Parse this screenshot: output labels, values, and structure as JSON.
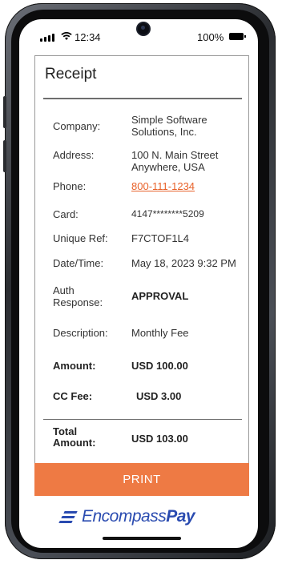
{
  "status": {
    "time": "12:34",
    "battery": "100%"
  },
  "receipt": {
    "title": "Receipt",
    "rows": [
      {
        "label": "Company:",
        "value": "Simple Software Solutions, Inc."
      },
      {
        "label": "Address:",
        "value": "100 N. Main Street Anywhere, USA"
      },
      {
        "label": "Phone:",
        "value": "800-111-1234"
      },
      {
        "label": "Card:",
        "value": "4147********5209"
      },
      {
        "label": "Unique Ref:",
        "value": "F7CTOF1L4"
      },
      {
        "label": "Date/Time:",
        "value": "May 18, 2023 9:32 PM"
      },
      {
        "label": "Auth Response:",
        "value": "APPROVAL"
      },
      {
        "label": "Description:",
        "value": "Monthly Fee"
      },
      {
        "label": "Amount:",
        "value": "USD 100.00"
      },
      {
        "label": "CC Fee:",
        "value": "USD 3.00"
      },
      {
        "label": "Total Amount:",
        "value": "USD 103.00"
      }
    ]
  },
  "actions": {
    "print_label": "PRINT"
  },
  "brand": {
    "name_light": "Encompass",
    "name_bold": "Pay",
    "color": "#2a4bb0"
  },
  "colors": {
    "accent": "#ee7a44",
    "link": "#e8622a"
  }
}
